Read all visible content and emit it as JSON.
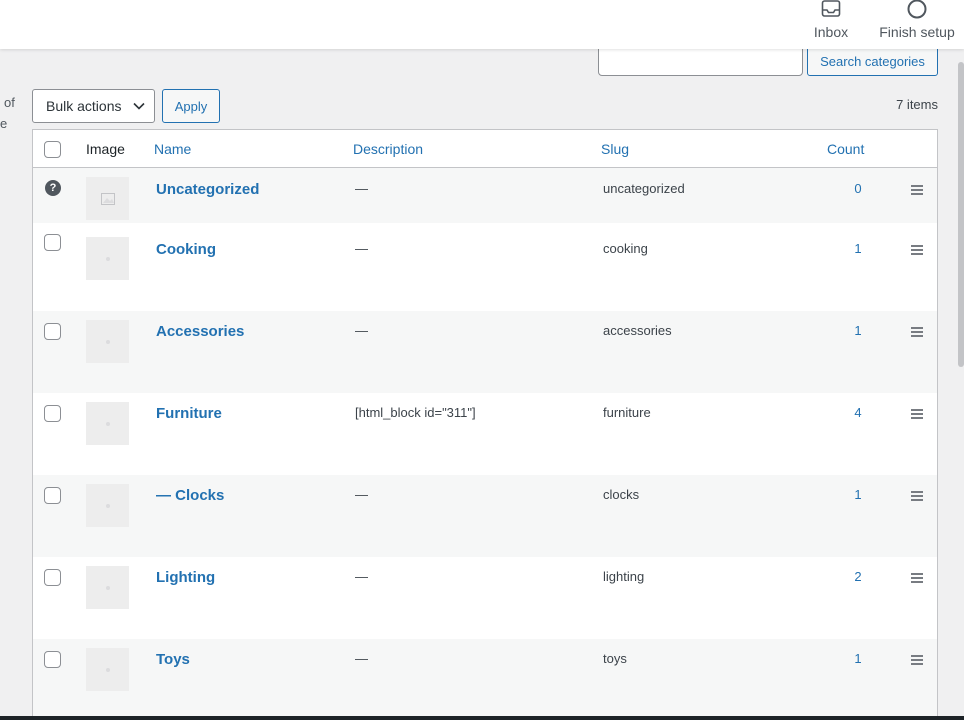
{
  "topbar": {
    "inbox_label": "Inbox",
    "inbox_icon": "inbox-icon",
    "finish_label": "Finish setup",
    "finish_icon": "circle-progress-icon"
  },
  "left_cut": {
    "line1": "of",
    "line2": "e"
  },
  "search": {
    "input_value": "",
    "button_label": "Search categories"
  },
  "bulk": {
    "selected": "Bulk actions",
    "apply_label": "Apply",
    "items_count": "7 items"
  },
  "table": {
    "columns": {
      "image": "Image",
      "name": "Name",
      "description": "Description",
      "slug": "Slug",
      "count": "Count"
    },
    "rows": [
      {
        "name": "Uncategorized",
        "description": "—",
        "slug": "uncategorized",
        "count": "0"
      },
      {
        "name": "Cooking",
        "description": "—",
        "slug": "cooking",
        "count": "1"
      },
      {
        "name": "Accessories",
        "description": "—",
        "slug": "accessories",
        "count": "1"
      },
      {
        "name": "Furniture",
        "description": "[html_block id=\"311\"]",
        "slug": "furniture",
        "count": "4"
      },
      {
        "name": "— Clocks",
        "description": "—",
        "slug": "clocks",
        "count": "1"
      },
      {
        "name": "Lighting",
        "description": "—",
        "slug": "lighting",
        "count": "2"
      },
      {
        "name": "Toys",
        "description": "—",
        "slug": "toys",
        "count": "1"
      }
    ]
  },
  "colors": {
    "link": "#2271b1",
    "background": "#f0f0f1",
    "border": "#c3c4c7"
  }
}
